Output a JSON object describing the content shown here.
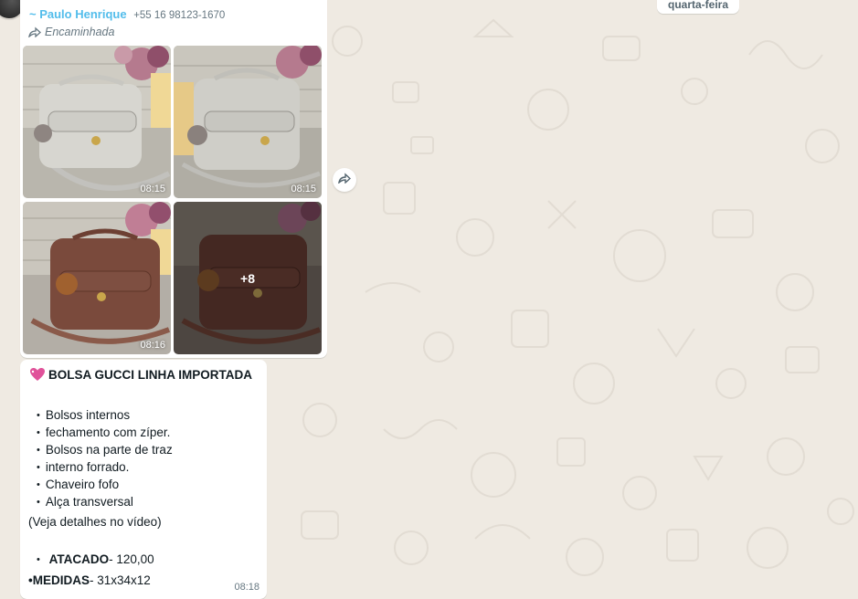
{
  "chat": {
    "date_divider": "quarta-feira",
    "album": {
      "sender_name": "~ Paulo Henrique",
      "sender_phone": "+55 16 98123-1670",
      "forwarded_label": "Encaminhada",
      "tiles": [
        {
          "time": "08:15",
          "bag": "grey"
        },
        {
          "time": "08:15",
          "bag": "grey"
        },
        {
          "time": "08:16",
          "bag": "brown"
        },
        {
          "more": "+8",
          "bag": "brown-dark"
        }
      ]
    },
    "text_message": {
      "title": "BOLSA GUCCI LINHA IMPORTADA",
      "bullets": [
        "Bolsos internos",
        "fechamento com zíper.",
        "Bolsos na parte de traz",
        "interno forrado.",
        "Chaveiro fofo",
        "Alça transversal"
      ],
      "note": "(Veja detalhes no vídeo)",
      "price_label": "ATACADO",
      "price_value": "- 120,00",
      "measures_label": "•MEDIDAS",
      "measures_value": "- 31x34x12",
      "time": "08:18"
    }
  },
  "colors": {
    "background": "#efeae2",
    "sender": "#53bdeb",
    "meta_text": "#667781"
  }
}
